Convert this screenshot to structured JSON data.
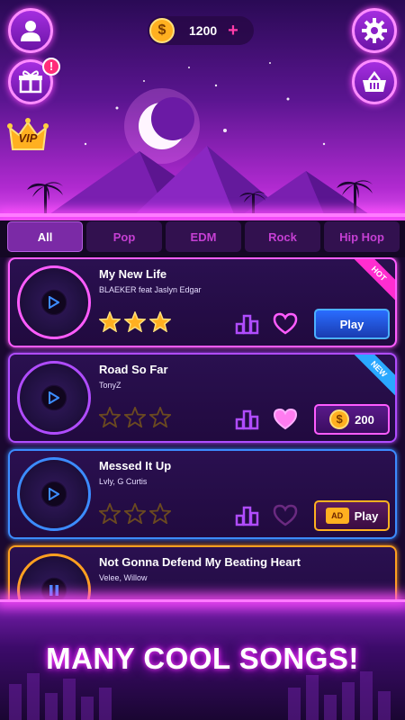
{
  "header": {
    "coins": {
      "amount": "1200",
      "plus": "+",
      "coin_symbol": "$"
    },
    "notification_badge": "!",
    "vip_label": "VIP"
  },
  "tabs": [
    {
      "label": "All",
      "active": true
    },
    {
      "label": "Pop",
      "active": false
    },
    {
      "label": "EDM",
      "active": false
    },
    {
      "label": "Rock",
      "active": false
    },
    {
      "label": "Hip Hop",
      "active": false
    }
  ],
  "songs": [
    {
      "title": "My New Life",
      "artist": "BLAEKER feat Jaslyn Edgar",
      "ribbon": "HOT",
      "stars_earned": 3,
      "action": {
        "type": "play",
        "label": "Play"
      },
      "favorite": false,
      "accent": "#ff5cff"
    },
    {
      "title": "Road So Far",
      "artist": "TonyZ",
      "ribbon": "NEW",
      "stars_earned": 0,
      "action": {
        "type": "price",
        "label": "200",
        "coin_symbol": "$"
      },
      "favorite": true,
      "accent": "#b04cff"
    },
    {
      "title": "Messed It Up",
      "artist": "Lvly, G Curtis",
      "ribbon": "",
      "stars_earned": 0,
      "action": {
        "type": "ad",
        "label": "Play",
        "ad_label": "AD"
      },
      "favorite": false,
      "accent": "#3c8cff"
    },
    {
      "title": "Not Gonna Defend My Beating Heart",
      "artist": "Velee, Willow",
      "ribbon": "",
      "stars_earned": 0,
      "action": {
        "type": "none",
        "label": ""
      },
      "favorite": false,
      "accent": "#ffa020"
    }
  ],
  "banner": "MANY COOL SONGS!",
  "colors": {
    "neon_pink": "#ff5cff",
    "star_gold": "#ffb020",
    "play_blue": "#2a6cff"
  }
}
